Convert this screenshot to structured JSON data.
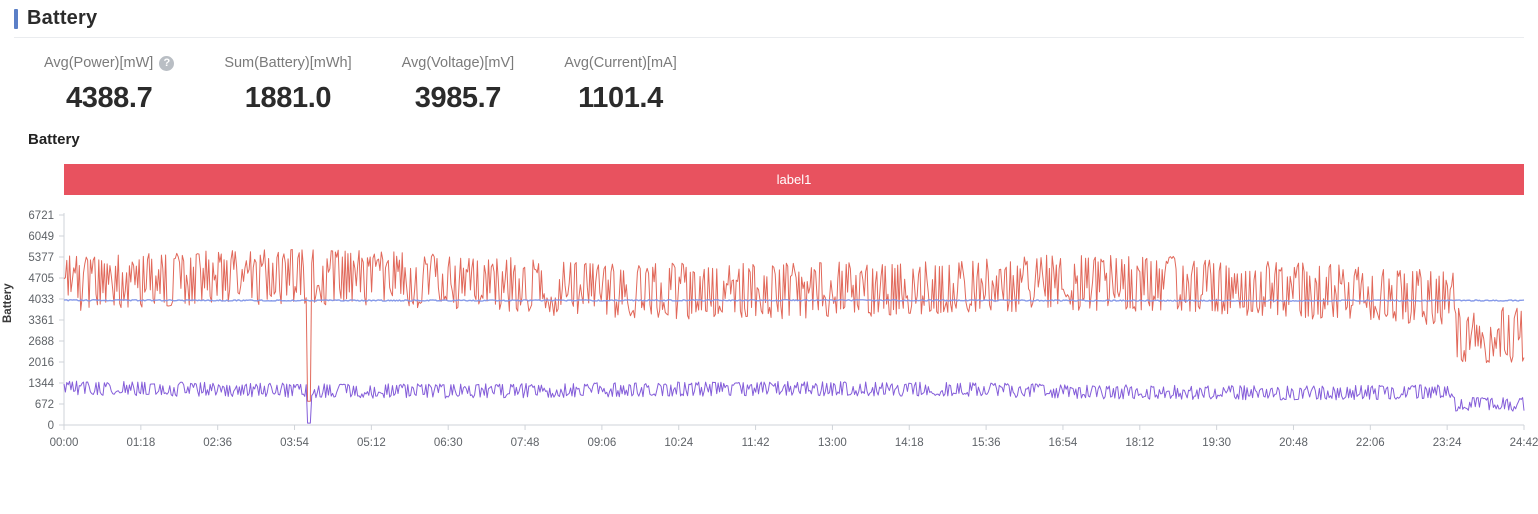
{
  "header": {
    "title": "Battery",
    "accent_color": "#5b7fc7"
  },
  "stats": [
    {
      "label": "Avg(Power)[mW]",
      "value": "4388.7",
      "has_help_icon": true,
      "help_glyph": "?"
    },
    {
      "label": "Sum(Battery)[mWh]",
      "value": "1881.0",
      "has_help_icon": false,
      "help_glyph": ""
    },
    {
      "label": "Avg(Voltage)[mV]",
      "value": "3985.7",
      "has_help_icon": false,
      "help_glyph": ""
    },
    {
      "label": "Avg(Current)[mA]",
      "value": "1101.4",
      "has_help_icon": false,
      "help_glyph": ""
    }
  ],
  "chart_heading": "Battery",
  "legend": {
    "label": "label1",
    "color": "#e8525f"
  },
  "watermark": "",
  "chart_data": {
    "type": "line",
    "title": "Battery",
    "xlabel": "",
    "ylabel": "Battery",
    "grid": false,
    "legend_position": "top-band",
    "xlim": [
      "00:00",
      "24:42"
    ],
    "ylim": [
      0,
      6721
    ],
    "x_ticks": [
      "00:00",
      "01:18",
      "02:36",
      "03:54",
      "05:12",
      "06:30",
      "07:48",
      "09:06",
      "10:24",
      "11:42",
      "13:00",
      "14:18",
      "15:36",
      "16:54",
      "18:12",
      "19:30",
      "20:48",
      "22:06",
      "23:24",
      "24:42"
    ],
    "y_ticks": [
      0,
      672,
      1344,
      2016,
      2688,
      3361,
      4033,
      4705,
      5377,
      6049,
      6721
    ],
    "series": [
      {
        "name": "Power",
        "unit": "mW",
        "color": "#de5b4c",
        "mean": 4388.7,
        "noise_amplitude": 900,
        "description": "High-frequency noisy power trace centered near 4400 mW, spiking to ~6700 and dipping to ~2700; drops to ~3200 average after 23:30 with one deep spike down to ~700 near 04:10."
      },
      {
        "name": "Voltage",
        "unit": "mV",
        "color": "#8095e8",
        "mean": 3985.7,
        "noise_amplitude": 18,
        "description": "Near-flat horizontal line at about 3985 mV spanning the full time range."
      },
      {
        "name": "Current",
        "unit": "mA",
        "color": "#7a4fd6",
        "mean": 1101.4,
        "noise_amplitude": 230,
        "description": "Noisy trace centered near 1100 mA, dipping below 700 after 23:30 and one deep dip to near 0 around 04:10."
      }
    ]
  }
}
